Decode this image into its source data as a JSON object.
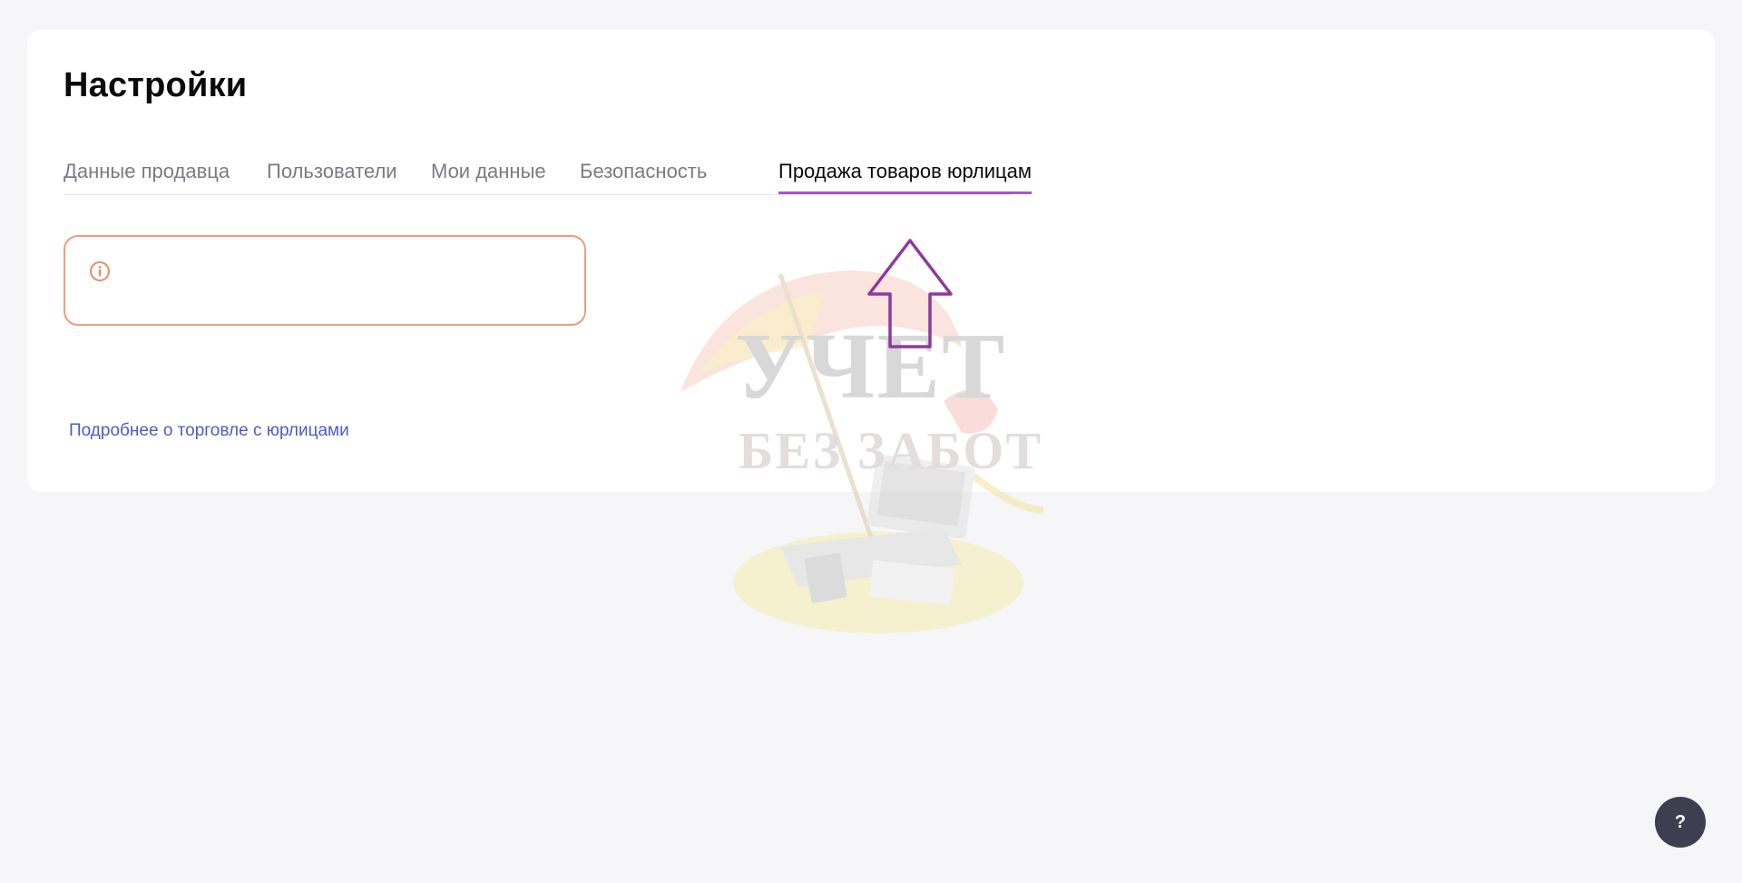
{
  "page": {
    "title": "Настройки"
  },
  "tabs": [
    {
      "label": "Данные продавца",
      "active": false
    },
    {
      "label": "Пользователи",
      "active": false
    },
    {
      "label": "Мои данные",
      "active": false
    },
    {
      "label": "Безопасность",
      "active": false
    },
    {
      "label": "Продажа товаров юрлицам",
      "active": true
    }
  ],
  "notice": {
    "icon": "info-icon",
    "border_color": "#ee9c7d"
  },
  "links": {
    "more": "Подробнее о торговле с юрлицами"
  },
  "watermark": {
    "title": "УЧЕТ",
    "subtitle": "БЕЗ ЗАБОТ"
  },
  "help": {
    "label": "?"
  },
  "colors": {
    "accent": "#a555d4",
    "link": "#4b5cc7",
    "annotation_arrow": "#8e3a9a"
  }
}
